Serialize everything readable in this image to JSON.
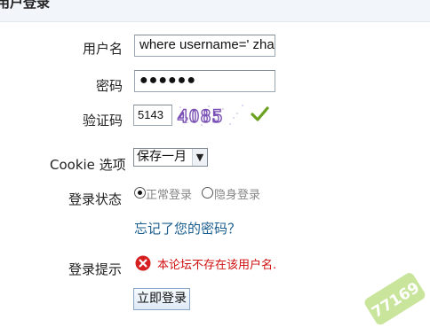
{
  "panel": {
    "title": "用户登录"
  },
  "form": {
    "username_label": "用户名",
    "username_value": "where username=' zhan",
    "password_label": "密码",
    "password_value": "●●●●●●",
    "captcha_label": "验证码",
    "captcha_input_value": "5143",
    "captcha_image_text": "4085",
    "cookie_label": "Cookie 选项",
    "cookie_selected": "保存一月",
    "status_label": "登录状态",
    "status_options": [
      "正常登录",
      "隐身登录"
    ],
    "status_selected_index": 0,
    "forgot_link": "忘记了您的密码？",
    "hint_label": "登录提示",
    "hint_message": "本论坛不存在该用户名.",
    "submit_label": "立即登录"
  },
  "watermark": {
    "text": "77169"
  },
  "colors": {
    "link": "#1a5d8f",
    "error": "#d01010",
    "check": "#6aa121"
  },
  "icons": {
    "captcha_ok": "check-icon",
    "error": "error-x-icon",
    "select": "chevron-down-icon"
  }
}
